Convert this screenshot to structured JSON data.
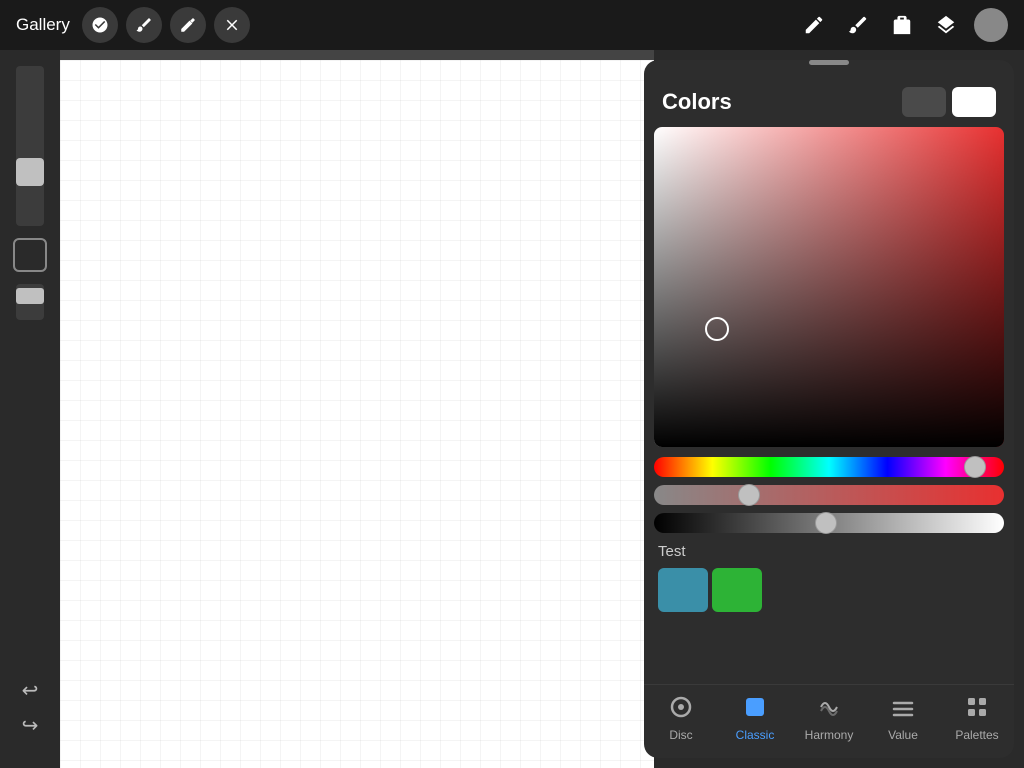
{
  "toolbar": {
    "gallery_label": "Gallery",
    "tools": [
      {
        "name": "modify-tool",
        "icon": "⚙"
      },
      {
        "name": "brush-tool",
        "icon": "✏"
      },
      {
        "name": "smudge-tool",
        "icon": "S"
      },
      {
        "name": "eraser-tool",
        "icon": "➤"
      }
    ],
    "right_tools": [
      {
        "name": "pen-icon",
        "icon": "✒"
      },
      {
        "name": "brush-icon",
        "icon": "🖌"
      },
      {
        "name": "eraser-icon",
        "icon": "◻"
      },
      {
        "name": "layers-icon",
        "icon": "⧉"
      }
    ]
  },
  "colors_panel": {
    "title": "Colors",
    "swatch_dark_label": "dark swatch",
    "swatch_light_label": "light swatch",
    "hue_slider_position_pct": 94,
    "sat_slider_position_pct": 28,
    "val_slider_position_pct": 50,
    "test_section": {
      "label": "Test",
      "colors": [
        "#3a8fa8",
        "#2db336"
      ]
    },
    "nav_items": [
      {
        "id": "disc",
        "label": "Disc",
        "active": false
      },
      {
        "id": "classic",
        "label": "Classic",
        "active": true
      },
      {
        "id": "harmony",
        "label": "Harmony",
        "active": false
      },
      {
        "id": "value",
        "label": "Value",
        "active": false
      },
      {
        "id": "palettes",
        "label": "Palettes",
        "active": false
      }
    ]
  },
  "icons": {
    "undo": "↩",
    "redo": "↪"
  }
}
